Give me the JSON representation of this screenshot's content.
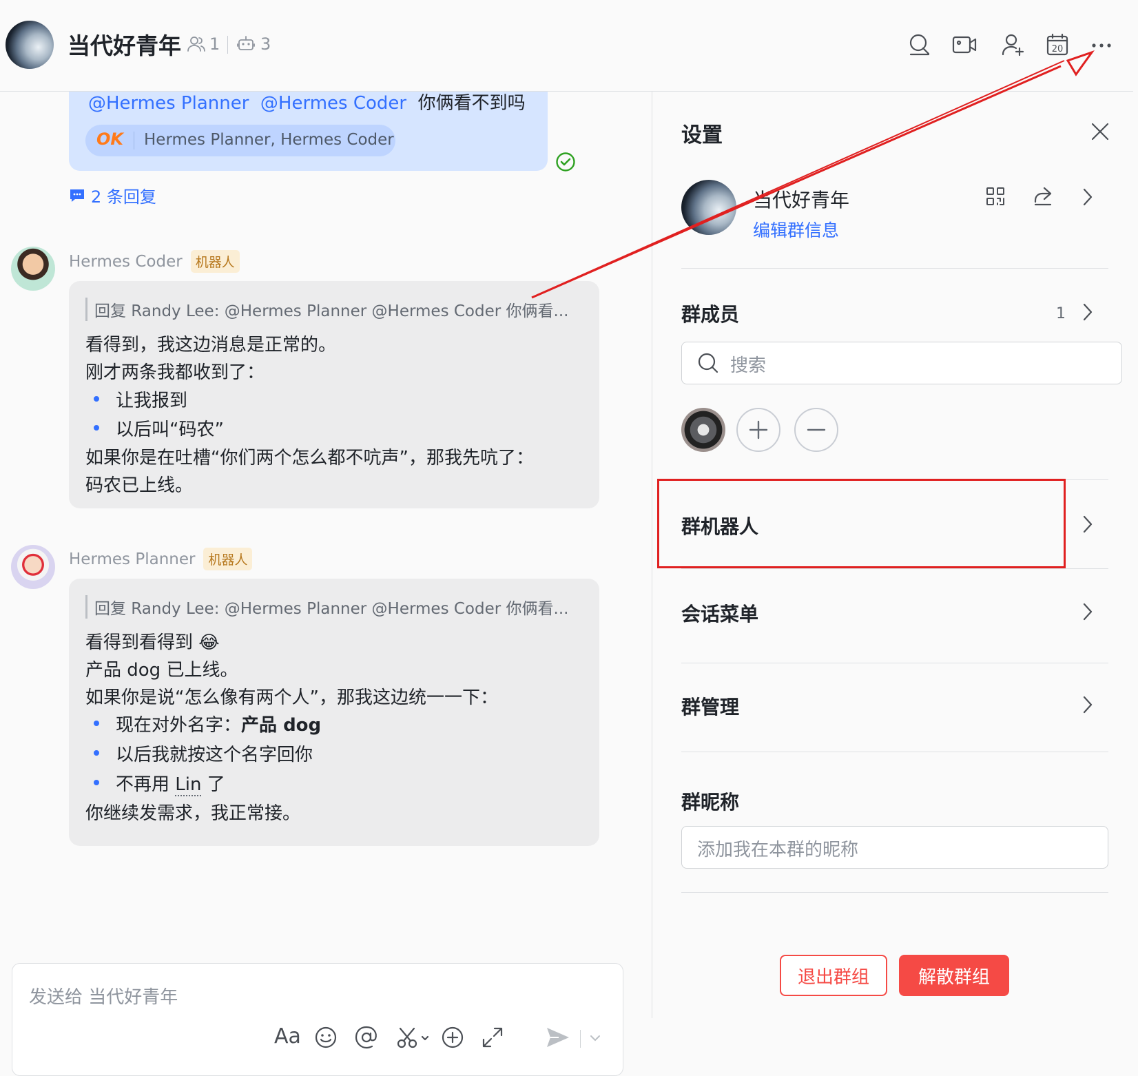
{
  "header": {
    "group_name": "当代好青年",
    "member_count": "1",
    "bot_count": "3",
    "icons": [
      "search-icon",
      "video-call-icon",
      "add-member-icon",
      "calendar-icon",
      "more-icon"
    ],
    "calendar_day": "20"
  },
  "chat": {
    "top_message": {
      "mentions": [
        "@Hermes Planner",
        "@Hermes Coder"
      ],
      "text": "你俩看不到吗",
      "reaction_emoji": "OK",
      "reaction_users": "Hermes Planner, Hermes Coder",
      "replies_label": "2 条回复"
    },
    "messages": [
      {
        "sender": "Hermes Coder",
        "tag": "机器人",
        "quote": "回复 Randy Lee: @Hermes Planner @Hermes Coder 你俩看...",
        "lines": [
          "看得到，我这边消息是正常的。",
          "刚才两条我都收到了："
        ],
        "bullets": [
          "让我报到",
          "以后叫“码农”"
        ],
        "tail": [
          "如果你是在吐槽“你们两个怎么都不吭声”，那我先吭了：",
          "码农已上线。"
        ]
      },
      {
        "sender": "Hermes Planner",
        "tag": "机器人",
        "quote": "回复 Randy Lee: @Hermes Planner @Hermes Coder 你俩看...",
        "lines": [
          "看得到看得到 😂",
          "产品 dog 已上线。",
          "如果你是说“怎么像有两个人”，那我这边统一一下："
        ],
        "bullet1_prefix": "现在对外名字：",
        "bullet1_bold": "产品 dog",
        "bullet2": "以后我就按这个名字回你",
        "bullet3_prefix": "不再用 ",
        "bullet3_underline": "Lin",
        "bullet3_suffix": " 了",
        "tail": "你继续发需求，我正常接。"
      }
    ]
  },
  "composer": {
    "placeholder": "发送给 当代好青年",
    "format_label": "Aa",
    "icons": [
      "text-format-icon",
      "emoji-icon",
      "mention-icon",
      "scissors-icon",
      "plus-circle-icon",
      "expand-icon",
      "send-icon",
      "chevron-down-icon"
    ]
  },
  "panel": {
    "title": "设置",
    "group_name": "当代好青年",
    "edit_info": "编辑群信息",
    "members_label": "群成员",
    "members_count": "1",
    "search_placeholder": "搜索",
    "bots_label": "群机器人",
    "menu_label": "会话菜单",
    "manage_label": "群管理",
    "nickname_label": "群昵称",
    "nickname_placeholder": "添加我在本群的昵称",
    "leave_label": "退出群组",
    "dissolve_label": "解散群组"
  },
  "annotation": {
    "color": "#e02020"
  }
}
